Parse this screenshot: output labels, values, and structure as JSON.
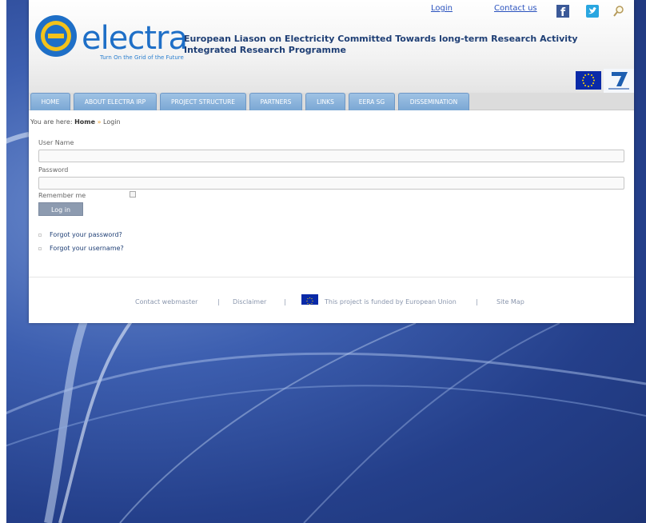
{
  "header": {
    "logo_text": "electra",
    "tagline": "Turn On the Grid of the Future",
    "title_line1": "European Liason on Electricity Committed Towards long-term Research Activity",
    "title_line2": "Integrated Research Programme",
    "login_link": "Login",
    "contact_link": "Contact us"
  },
  "nav": {
    "items": [
      {
        "label": "HOME"
      },
      {
        "label": "ABOUT ELECTRA IRP"
      },
      {
        "label": "PROJECT STRUCTURE"
      },
      {
        "label": "PARTNERS"
      },
      {
        "label": "LINKS"
      },
      {
        "label": "EERA SG"
      },
      {
        "label": "DISSEMINATION"
      }
    ]
  },
  "breadcrumb": {
    "prefix": "You are here:",
    "home": "Home",
    "separator": "»",
    "current": "Login"
  },
  "form": {
    "username_label": "User Name",
    "username_value": "",
    "password_label": "Password",
    "password_value": "",
    "remember_label": "Remember me",
    "remember_checked": false,
    "login_button": "Log in",
    "forgot_password": "Forgot your password?",
    "forgot_username": "Forgot your username?"
  },
  "footer": {
    "contact_webmaster": "Contact webmaster",
    "disclaimer": "Disclaimer",
    "funded_text": "This project is funded by European Union",
    "site_map": "Site Map",
    "separator": "|"
  },
  "colors": {
    "brand_blue": "#1e6fc7",
    "nav_tab": "#7aa7d4",
    "background": "#2f4f9a",
    "button": "#8d9bb0"
  },
  "icons": [
    "facebook-icon",
    "twitter-icon",
    "search-icon",
    "eu-flag-icon",
    "fp7-logo-icon",
    "electra-logo-icon"
  ]
}
